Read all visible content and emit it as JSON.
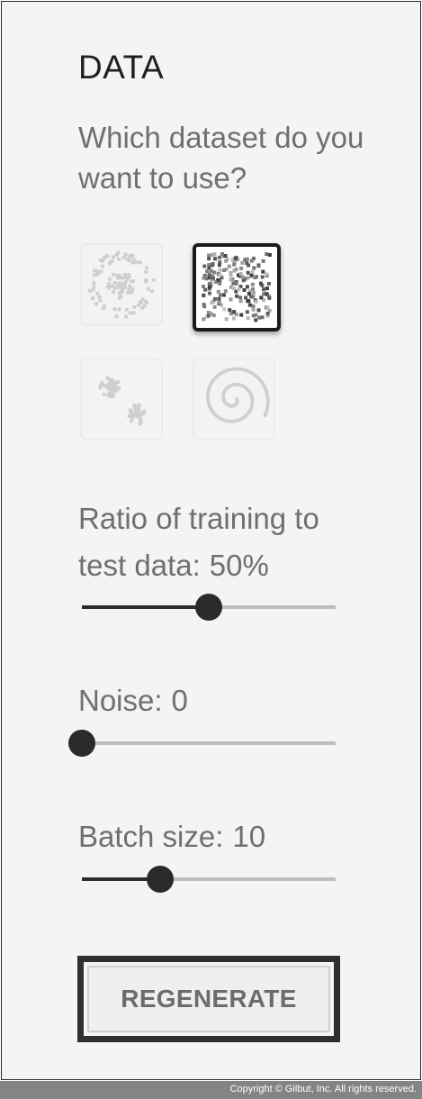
{
  "data_section": {
    "title": "DATA",
    "question": "Which dataset do you want to use?"
  },
  "datasets": [
    {
      "name": "circle",
      "selected": false
    },
    {
      "name": "xor",
      "selected": true
    },
    {
      "name": "gaussian",
      "selected": false
    },
    {
      "name": "spiral",
      "selected": false
    }
  ],
  "ratio": {
    "label": "Ratio of training to test data:",
    "value": "50%",
    "fraction": 0.5
  },
  "noise": {
    "label": "Noise:",
    "value": "0",
    "fraction": 0.0
  },
  "batch": {
    "label": "Batch size:",
    "value": "10",
    "fraction": 0.31
  },
  "regenerate_label": "REGENERATE",
  "footer": {
    "copyright": "Copyright © Gilbut, Inc. All rights reserved."
  },
  "colors": {
    "knob": "#2a2a2a",
    "rail": "#bdbdbd",
    "fill": "#2d2d2d"
  }
}
